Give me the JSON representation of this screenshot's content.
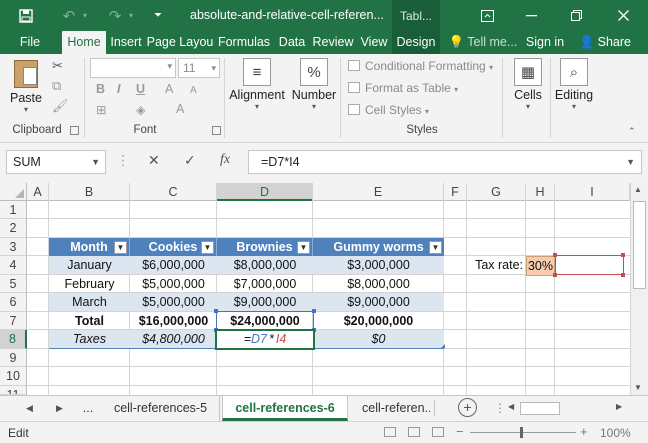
{
  "title_bar": {
    "title": "absolute-and-relative-cell-referen...",
    "context_tab": "Tabl...",
    "save_icon": "save-icon",
    "undo_icon": "undo-icon",
    "redo_icon": "redo-icon"
  },
  "ribbon_tabs": {
    "file": "File",
    "home": "Home",
    "insert": "Insert",
    "page_layout": "Page Layou",
    "formulas": "Formulas",
    "data": "Data",
    "review": "Review",
    "view": "View",
    "design": "Design",
    "tell_me": "Tell me...",
    "sign_in": "Sign in",
    "share": "Share"
  },
  "ribbon": {
    "paste": "Paste",
    "font_size": "11",
    "alignment": "Alignment",
    "number": "Number",
    "number_symbol": "%",
    "conditional_formatting": "Conditional Formatting",
    "format_as_table": "Format as Table",
    "cell_styles": "Cell Styles",
    "cells": "Cells",
    "editing": "Editing",
    "groups": {
      "clipboard": "Clipboard",
      "font": "Font",
      "styles": "Styles"
    }
  },
  "formula_bar": {
    "name_box": "SUM",
    "fx_label": "fx",
    "formula": "=D7*I4"
  },
  "columns": [
    "A",
    "B",
    "C",
    "D",
    "E",
    "F",
    "G",
    "H",
    "I"
  ],
  "rows": [
    "1",
    "2",
    "3",
    "4",
    "5",
    "6",
    "7",
    "8",
    "9",
    "10",
    "11"
  ],
  "table": {
    "headers": [
      "Month",
      "Cookies",
      "Brownies",
      "Gummy worms"
    ],
    "rows": [
      [
        "January",
        "$6,000,000",
        "$8,000,000",
        "$3,000,000"
      ],
      [
        "February",
        "$5,000,000",
        "$7,000,000",
        "$8,000,000"
      ],
      [
        "March",
        "$5,000,000",
        "$9,000,000",
        "$9,000,000"
      ],
      [
        "Total",
        "$16,000,000",
        "$24,000,000",
        "$20,000,000"
      ],
      [
        "Taxes",
        "$4,800,000",
        "=D7*I4",
        "$0"
      ]
    ]
  },
  "tax": {
    "label": "Tax rate:",
    "value": "30%"
  },
  "editing_formula": {
    "eq": "=",
    "ref1": "D7",
    "op": "*",
    "ref2": "I4"
  },
  "sheet_tabs": {
    "more": "...",
    "tabs": [
      "cell-references-5",
      "cell-references-6",
      "cell-referen..."
    ],
    "active": "cell-references-6"
  },
  "status_bar": {
    "mode": "Edit",
    "zoom": "100%"
  },
  "colors": {
    "accent": "#217346",
    "table_header": "#4f81bd",
    "band": "#dce6f1",
    "ref1": "#4472c4",
    "ref2": "#c0504d",
    "tax_fill": "#f8cbad"
  }
}
